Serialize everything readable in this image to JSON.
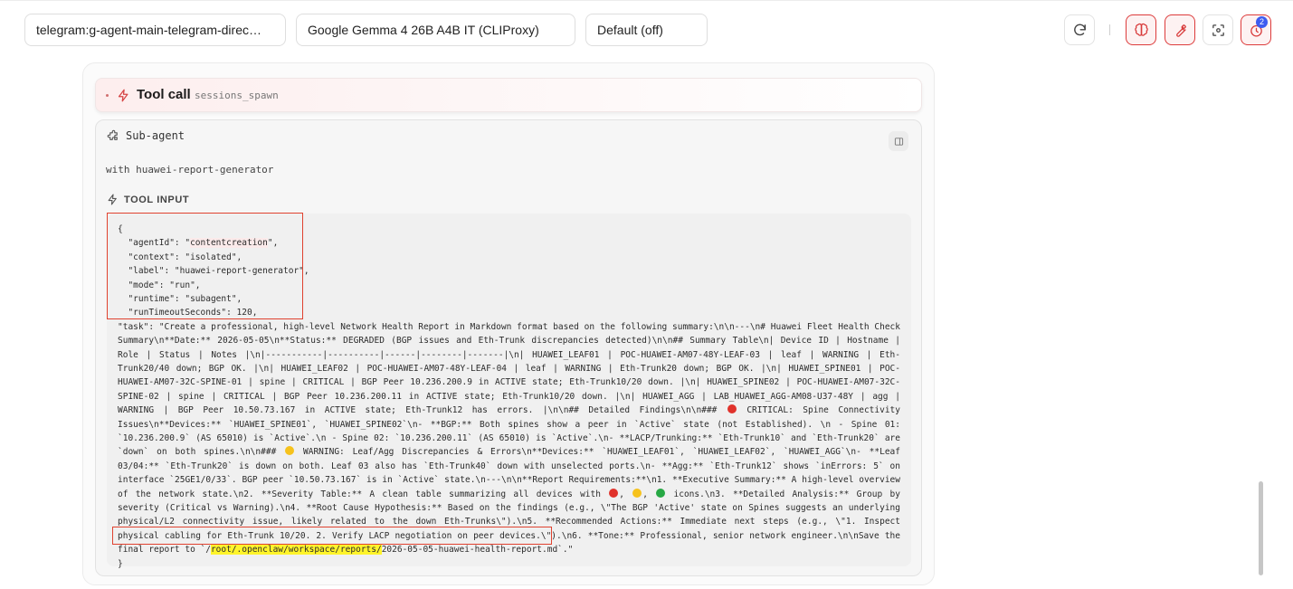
{
  "topbar": {
    "session_select": "telegram:g-agent-main-telegram-direc…",
    "model_select": "Google Gemma 4 26B A4B IT (CLIProxy)",
    "thinking_select": "Default (off)",
    "history_badge": "2"
  },
  "toolcall": {
    "title": "Tool call",
    "name": "sessions_spawn"
  },
  "subagent": {
    "title": "Sub-agent",
    "with_line": "with huawei-report-generator",
    "tool_input_label": "TOOL INPUT"
  },
  "code": {
    "open_brace": "{",
    "agent_key": "  \"agentId\": \"",
    "agent_value": "contentcreation",
    "agent_tail": "\",",
    "line_context": "  \"context\": \"isolated\",",
    "line_label": "  \"label\": \"huawei-report-generator\",",
    "line_mode": "  \"mode\": \"run\",",
    "line_runtime": "  \"runtime\": \"subagent\",",
    "line_timeout": "  \"runTimeoutSeconds\": 120,",
    "task_part1": "  \"task\": \"Create a professional, high-level Network Health Report in Markdown format based on the following summary:\\n\\n---\\n# Huawei Fleet Health Check Summary\\n**Date:** 2026-05-05\\n**Status:** DEGRADED (BGP issues and Eth-Trunk discrepancies detected)\\n\\n## Summary Table\\n| Device ID | Hostname | Role | Status | Notes |\\n|-----------|----------|------|--------|-------|\\n| HUAWEI_LEAF01 | POC-HUAWEI-AM07-48Y-LEAF-03 | leaf | WARNING | Eth-Trunk20/40 down; BGP OK. |\\n| HUAWEI_LEAF02 | POC-HUAWEI-AM07-48Y-LEAF-04 | leaf | WARNING | Eth-Trunk20 down; BGP OK. |\\n| HUAWEI_SPINE01 | POC-HUAWEI-AM07-32C-SPINE-01 | spine | CRITICAL | BGP Peer 10.236.200.9 in ACTIVE state; Eth-Trunk10/20 down. |\\n| HUAWEI_SPINE02 | POC-HUAWEI-AM07-32C-SPINE-02 | spine | CRITICAL | BGP Peer 10.236.200.11 in ACTIVE state; Eth-Trunk10/20 down. |\\n| HUAWEI_AGG | LAB_HUAWEI_AGG-AM08-U37-48Y | agg | WARNING | BGP Peer 10.50.73.167 in ACTIVE state; Eth-Trunk12 has errors. |\\n\\n## Detailed Findings\\n\\n### ",
    "task_part2": " CRITICAL: Spine Connectivity Issues\\n**Devices:** `HUAWEI_SPINE01`, `HUAWEI_SPINE02`\\n- **BGP:** Both spines show a peer in `Active` state (not Established). \\n  - Spine 01: `10.236.200.9` (AS 65010) is `Active`.\\n  - Spine 02: `10.236.200.11` (AS 65010) is `Active`.\\n- **LACP/Trunking:** `Eth-Trunk10` and `Eth-Trunk20` are `down` on both spines.\\n\\n### ",
    "task_part3": " WARNING: Leaf/Agg Discrepancies & Errors\\n**Devices:** `HUAWEI_LEAF01`, `HUAWEI_LEAF02`, `HUAWEI_AGG`\\n- **Leaf 03/04:** `Eth-Trunk20` is down on both. Leaf 03 also has `Eth-Trunk40` down with unselected ports.\\n- **Agg:** `Eth-Trunk12` shows `inErrors: 5` on interface `25GE1/0/33`. BGP peer `10.50.73.167` is in `Active` state.\\n---\\n\\n**Report Requirements:**\\n1. **Executive Summary:** A high-level overview of the network state.\\n2. **Severity Table:** A clean table summarizing all devices with ",
    "task_part4": ", ",
    "task_part5": ", ",
    "task_part6": " icons.\\n3. **Detailed Analysis:** Group by severity (Critical vs Warning).\\n4. **Root Cause Hypothesis:** Based on the findings (e.g., \\\"The BGP 'Active' state on Spines suggests an underlying physical/L2 connectivity issue, likely related to the down Eth-Trunks\\\").\\n5. **Recommended Actions:** Immediate next steps (e.g., \\\"1. Inspect physical cabling for Eth-Trunk 10/20. 2. Verify LACP negotiation on peer devices.\\\").\\n6. **Tone:** Professional, senior network engineer.\\n\\nSave the final report to `/",
    "task_path_highlight": "root/.openclaw/workspace/reports/",
    "task_path_tail": "2026-05-05-huawei-health-report.md`.\"",
    "close_brace": "}"
  },
  "colors": {
    "accent_red": "#dd3b3b",
    "path_highlight": "#fff42a",
    "badge_blue": "#3d5cf0",
    "emoji_red": "#e0322b",
    "emoji_yellow": "#f6c21c",
    "emoji_green": "#27a844"
  }
}
